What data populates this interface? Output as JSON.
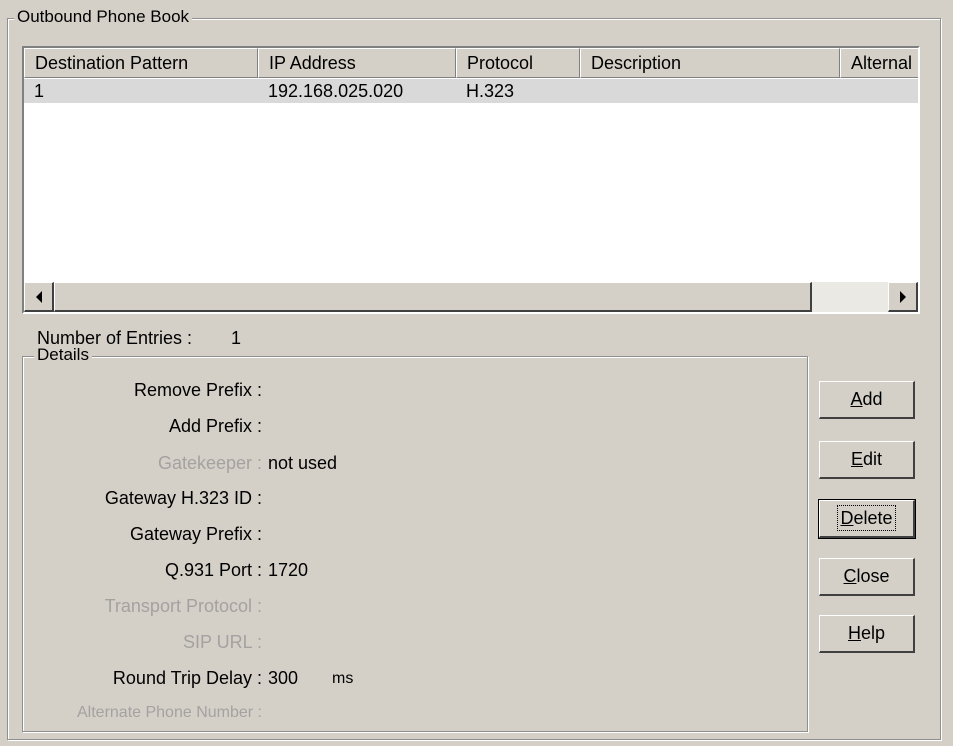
{
  "phonebook": {
    "title": "Outbound Phone Book",
    "columns": [
      "Destination Pattern",
      "IP Address",
      "Protocol",
      "Description",
      "Alternal"
    ],
    "rows": [
      {
        "pattern": "1",
        "ip": "192.168.025.020",
        "protocol": "H.323",
        "description": "",
        "alternate": ""
      }
    ],
    "entries_label": "Number of Entries :",
    "entries_count": "1"
  },
  "details": {
    "title": "Details",
    "remove_prefix_label": "Remove Prefix :",
    "remove_prefix_value": "",
    "add_prefix_label": "Add Prefix :",
    "add_prefix_value": "",
    "gatekeeper_label": "Gatekeeper :",
    "gatekeeper_value": "not used",
    "gateway_id_label": "Gateway H.323 ID :",
    "gateway_id_value": "",
    "gateway_prefix_label": "Gateway Prefix :",
    "gateway_prefix_value": "",
    "q931_port_label": "Q.931 Port :",
    "q931_port_value": "1720",
    "transport_label": "Transport Protocol :",
    "transport_value": "",
    "sip_url_label": "SIP URL :",
    "sip_url_value": "",
    "round_trip_label": "Round Trip Delay :",
    "round_trip_value": "300",
    "round_trip_unit": "ms",
    "alt_phone_label": "Alternate Phone Number :",
    "alt_phone_value": ""
  },
  "buttons": {
    "add": {
      "mnemonic": "A",
      "rest": "dd"
    },
    "edit": {
      "mnemonic": "E",
      "rest": "dit"
    },
    "delete": {
      "mnemonic": "D",
      "rest": "elete"
    },
    "close": {
      "mnemonic": "C",
      "rest": "lose"
    },
    "help": {
      "mnemonic": "H",
      "rest": "elp"
    }
  },
  "icons": {
    "scroll_left": "left-arrow",
    "scroll_right": "right-arrow"
  },
  "colors": {
    "dialog_bg": "#d4d0c8",
    "selected_row": "#d9d9d9",
    "disabled_text": "#a4a2a0"
  }
}
